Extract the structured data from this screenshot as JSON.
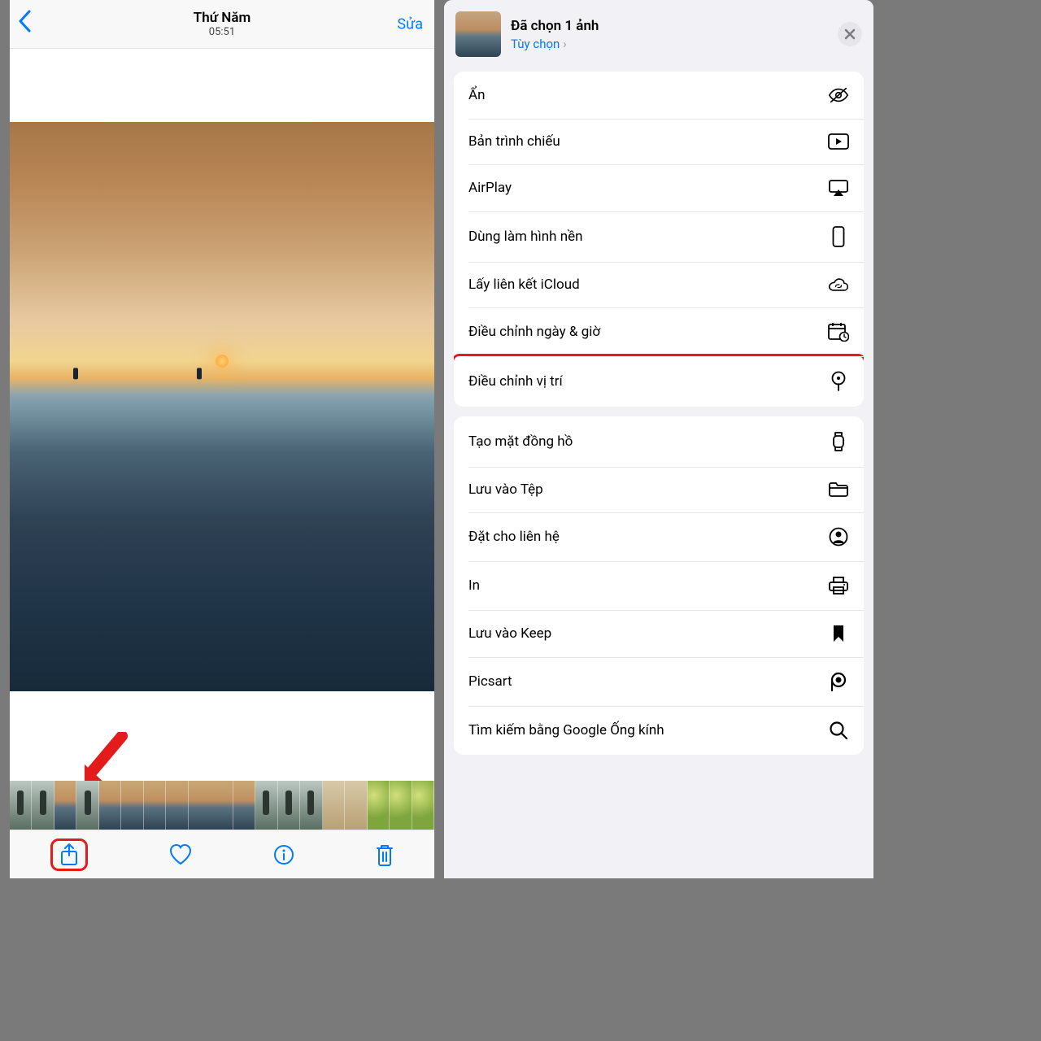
{
  "left": {
    "header_day": "Thứ Năm",
    "header_time": "05:51",
    "edit_label": "Sửa"
  },
  "right": {
    "selection_title": "Đã chọn 1 ảnh",
    "options_label": "Tùy chọn",
    "group1": [
      {
        "label": "Ẩn",
        "icon": "eye-slash"
      },
      {
        "label": "Bản trình chiếu",
        "icon": "play-rect"
      },
      {
        "label": "AirPlay",
        "icon": "airplay"
      },
      {
        "label": "Dùng làm hình nền",
        "icon": "phone"
      },
      {
        "label": "Lấy liên kết iCloud",
        "icon": "cloud-link"
      },
      {
        "label": "Điều chỉnh ngày & giờ",
        "icon": "calendar-clock"
      },
      {
        "label": "Điều chỉnh vị trí",
        "icon": "location-pin",
        "highlight": true
      }
    ],
    "group2": [
      {
        "label": "Tạo mặt đồng hồ",
        "icon": "watch"
      },
      {
        "label": "Lưu vào Tệp",
        "icon": "folder"
      },
      {
        "label": "Đặt cho liên hệ",
        "icon": "contact"
      },
      {
        "label": "In",
        "icon": "printer"
      },
      {
        "label": "Lưu vào Keep",
        "icon": "bookmark"
      },
      {
        "label": "Picsart",
        "icon": "picsart"
      },
      {
        "label": "Tìm kiếm bằng Google Ống kính",
        "icon": "search"
      }
    ]
  }
}
